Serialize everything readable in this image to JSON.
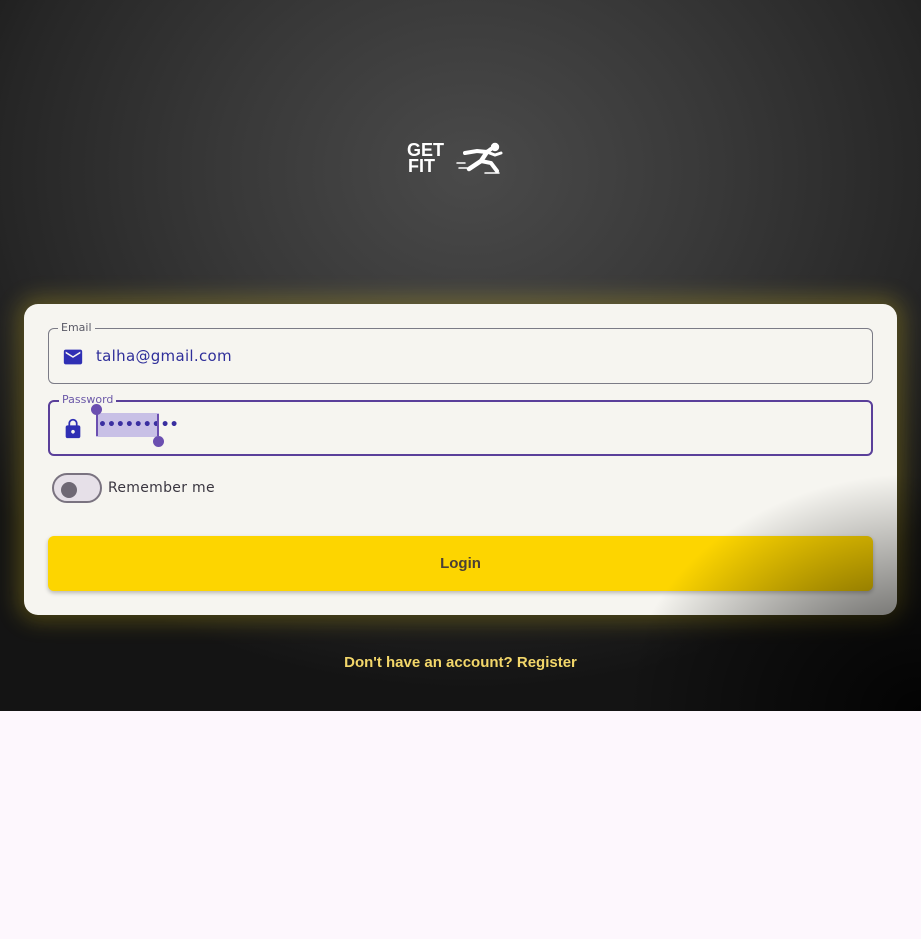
{
  "logo": {
    "line1": "GET",
    "line2": "FIT"
  },
  "form": {
    "email": {
      "label": "Email",
      "value": "talha@gmail.com",
      "icon": "mail-icon"
    },
    "password": {
      "label": "Password",
      "masked_value": "•••••••••",
      "icon": "lock-icon"
    },
    "remember": {
      "label": "Remember me",
      "checked": false
    },
    "login_label": "Login"
  },
  "register_link": "Don't have an account? Register",
  "colors": {
    "accent": "#fdd500",
    "icon": "#2f2fb4",
    "focus": "#5a3f9a",
    "card": "#f6f5f0"
  }
}
